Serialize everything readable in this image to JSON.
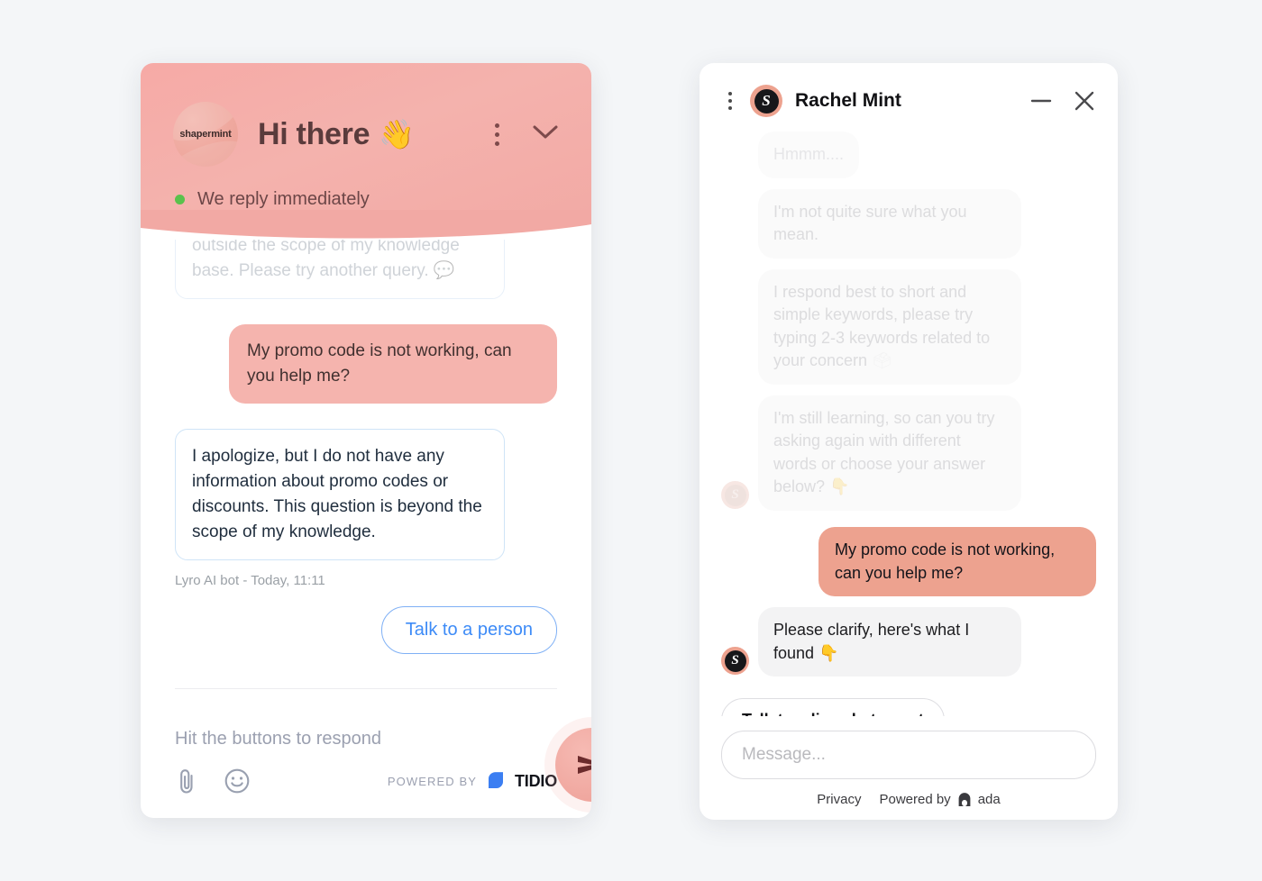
{
  "tidio": {
    "brand_name": "shapermint",
    "title": "Hi there",
    "title_emoji": "👋",
    "status": "We reply immediately",
    "menu_icon": "kebab-menu-icon",
    "collapse_icon": "chevron-down-icon",
    "messages": [
      {
        "id": "m1",
        "role": "bot",
        "state": "faded",
        "text": "outside the scope of my knowledge base. Please try another query.",
        "emoji": "💬"
      },
      {
        "id": "m2",
        "role": "user",
        "state": "normal",
        "text": "My promo code is not working, can you help me?"
      },
      {
        "id": "m3",
        "role": "bot",
        "state": "normal",
        "text": "I apologize, but I do not have any information about promo codes or discounts. This question is beyond the scope of my knowledge."
      }
    ],
    "message_meta": "Lyro AI bot - Today, 11:11",
    "quick_reply": "Talk to a person",
    "composer_placeholder": "Hit the buttons to respond",
    "attach_icon": "paperclip-icon",
    "emoji_icon": "smiley-face-icon",
    "send_icon": "send-paper-plane-icon",
    "powered_label": "POWERED BY",
    "powered_brand": "TIDIO"
  },
  "ada": {
    "menu_icon": "kebab-menu-icon",
    "agent_name": "Rachel Mint",
    "avatar_letter": "S",
    "minimize_icon": "minimize-icon",
    "close_icon": "close-icon",
    "messages": [
      {
        "id": "a1",
        "role": "bot",
        "state": "faded-strong",
        "text": "Hmmm...."
      },
      {
        "id": "a2",
        "role": "bot",
        "state": "faded",
        "text": "I'm not quite sure what you mean."
      },
      {
        "id": "a3",
        "role": "bot",
        "state": "faded",
        "text": "I respond best to short and simple keywords, please try typing 2-3 keywords related to your concern",
        "emoji": "🗳"
      },
      {
        "id": "a4",
        "role": "bot",
        "state": "faded",
        "show_avatar": true,
        "text": "I'm still learning, so can you try asking again with different words or choose your answer below?",
        "emoji": "👇"
      },
      {
        "id": "a5",
        "role": "user",
        "state": "normal",
        "text": "My promo code is not working, can you help me?"
      },
      {
        "id": "a6",
        "role": "bot",
        "state": "normal",
        "show_avatar": true,
        "text": "Please clarify, here's what I found",
        "emoji": "👇"
      }
    ],
    "cta_label": "Talk to a live chat agent",
    "input_placeholder": "Message...",
    "input_value": "",
    "privacy_label": "Privacy",
    "powered_by_label": "Powered by",
    "powered_brand": "ada",
    "powered_brand_icon": "ada-arch-logo-icon"
  },
  "colors": {
    "page_background": "#f4f6f8",
    "tidio_header_pink": "#f4b2ad",
    "tidio_user_bubble": "#f5b4ae",
    "tidio_accent_blue": "#3d8bf7",
    "tidio_status_green": "#5ac24c",
    "ada_user_bubble": "#eda28f",
    "ada_bot_bubble": "#f3f3f4",
    "tidio_brand_blue": "#3b7cf5"
  }
}
